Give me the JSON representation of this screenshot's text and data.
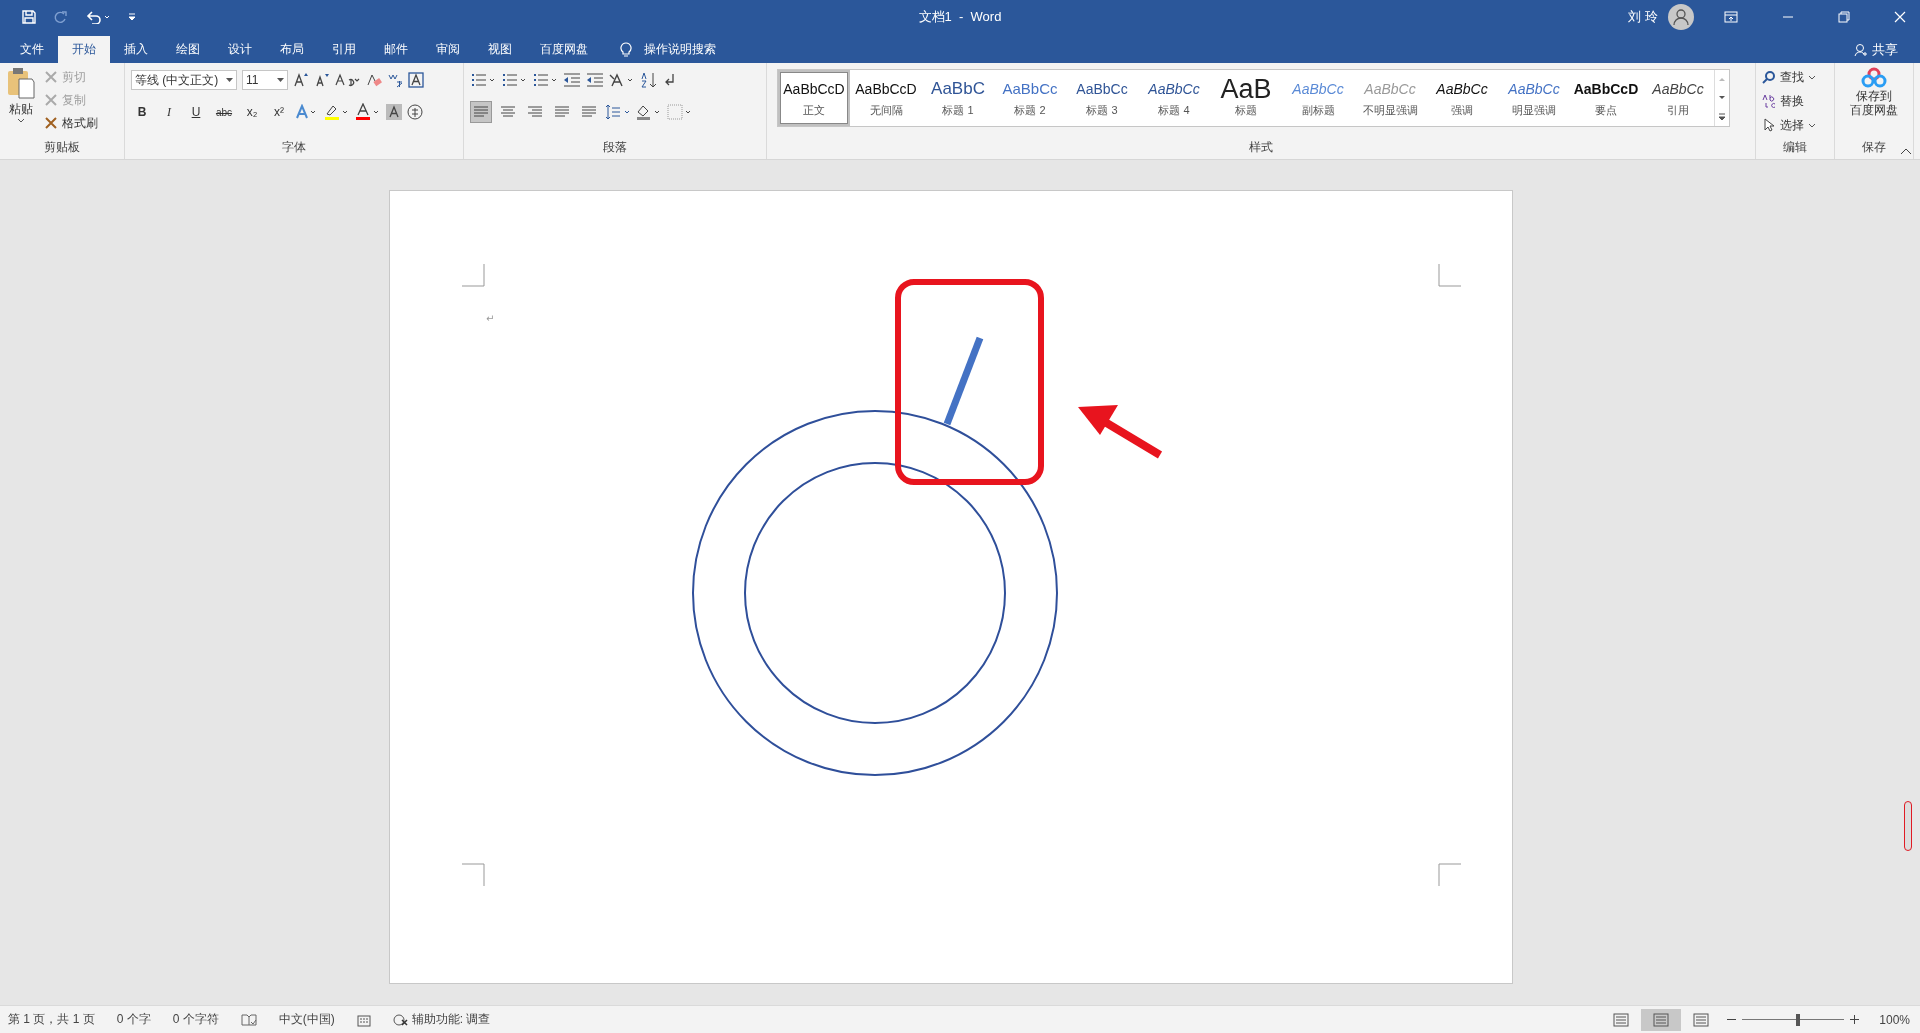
{
  "window": {
    "title": "文档1  -  Word",
    "user": "刘 玲"
  },
  "tabs": [
    {
      "label": "文件",
      "selected": false
    },
    {
      "label": "开始",
      "selected": true
    },
    {
      "label": "插入",
      "selected": false
    },
    {
      "label": "绘图",
      "selected": false
    },
    {
      "label": "设计",
      "selected": false
    },
    {
      "label": "布局",
      "selected": false
    },
    {
      "label": "引用",
      "selected": false
    },
    {
      "label": "邮件",
      "selected": false
    },
    {
      "label": "审阅",
      "selected": false
    },
    {
      "label": "视图",
      "selected": false
    },
    {
      "label": "百度网盘",
      "selected": false
    }
  ],
  "tell_me": "操作说明搜索",
  "share": "共享",
  "ribbon": {
    "clipboard": {
      "paste": "粘贴",
      "items": [
        {
          "label": "剪切",
          "disabled": true
        },
        {
          "label": "复制",
          "disabled": true
        },
        {
          "label": "格式刷",
          "disabled": false
        }
      ],
      "label": "剪贴板"
    },
    "font": {
      "font_name": "等线 (中文正文)",
      "font_size": "11",
      "format_buttons": [
        "B",
        "I",
        "U",
        "abc",
        "x₂",
        "x²"
      ],
      "label": "字体"
    },
    "paragraph": {
      "alignments": [
        {
          "selected": true
        },
        {
          "selected": false
        },
        {
          "selected": false
        },
        {
          "selected": false
        },
        {
          "selected": false
        }
      ],
      "label": "段落"
    },
    "styles": {
      "items": [
        {
          "preview": "AaBbCcD",
          "name": "正文",
          "kind": "normal",
          "selected": true
        },
        {
          "preview": "AaBbCcD",
          "name": "无间隔",
          "kind": "nospacing",
          "selected": false
        },
        {
          "preview": "AaBbC",
          "name": "标题 1",
          "kind": "h1",
          "selected": false
        },
        {
          "preview": "AaBbCc",
          "name": "标题 2",
          "kind": "h2",
          "selected": false
        },
        {
          "preview": "AaBbCc",
          "name": "标题 3",
          "kind": "h3",
          "selected": false
        },
        {
          "preview": "AaBbCc",
          "name": "标题 4",
          "kind": "h4",
          "selected": false
        },
        {
          "preview": "AaB",
          "name": "标题",
          "kind": "title",
          "selected": false
        },
        {
          "preview": "AaBbCc",
          "name": "副标题",
          "kind": "subtitle",
          "selected": false
        },
        {
          "preview": "AaBbCc",
          "name": "不明显强调",
          "kind": "subtle",
          "selected": false
        },
        {
          "preview": "AaBbCc",
          "name": "强调",
          "kind": "emphasis",
          "selected": false
        },
        {
          "preview": "AaBbCc",
          "name": "明显强调",
          "kind": "intense",
          "selected": false
        },
        {
          "preview": "AaBbCcD",
          "name": "要点",
          "kind": "strong",
          "selected": false
        },
        {
          "preview": "AaBbCc",
          "name": "引用",
          "kind": "quote",
          "selected": false
        }
      ],
      "label": "样式"
    },
    "editing": {
      "find": "查找",
      "replace": "替换",
      "select": "选择",
      "label": "编辑"
    },
    "save": {
      "lines": [
        "保存到",
        "百度网盘"
      ],
      "label": "保存"
    }
  },
  "document": {
    "paragraph_mark": "↵"
  },
  "status_bar": {
    "page": "第 1 页，共 1 页",
    "words": "0 个字",
    "chars": "0 个字符",
    "language": "中文(中国)",
    "accessibility": "辅助功能: 调查",
    "views": [
      {
        "selected": false
      },
      {
        "selected": true
      },
      {
        "selected": false
      }
    ],
    "zoom": {
      "level": 0.55,
      "reading": "100%"
    }
  }
}
